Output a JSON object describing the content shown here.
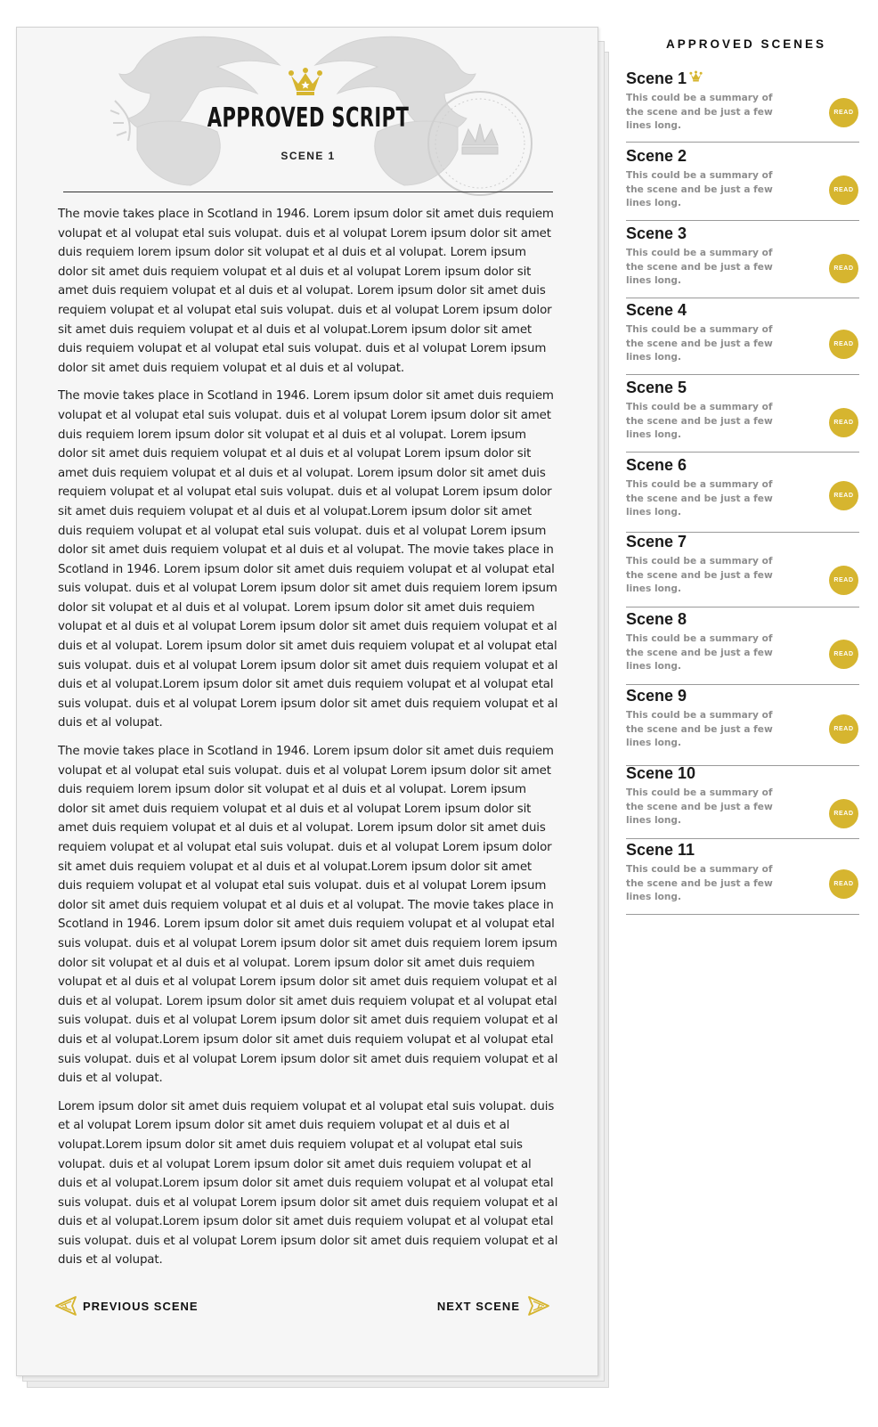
{
  "script": {
    "title": "APPROVED SCRIPT",
    "current_scene": "SCENE 1",
    "paragraphs": [
      "The movie takes place in Scotland in 1946. Lorem ipsum dolor sit amet duis requiem volupat et al volupat etal suis volupat. duis et al volupat Lorem ipsum dolor sit amet duis requiem lorem ipsum dolor sit volupat et al duis et al volupat. Lorem ipsum dolor sit amet duis requiem volupat et al duis et al volupat Lorem ipsum dolor sit amet duis requiem volupat et al duis et al volupat. Lorem ipsum dolor sit amet duis requiem volupat et al volupat etal suis volupat. duis et al volupat Lorem ipsum dolor sit amet duis requiem volupat et al duis et al volupat.Lorem ipsum dolor sit amet duis requiem volupat et al volupat etal suis volupat. duis et al volupat Lorem ipsum dolor sit amet duis requiem volupat et al duis et al volupat.",
      "The movie takes place in Scotland in 1946. Lorem ipsum dolor sit amet duis requiem volupat et al volupat etal suis volupat. duis et al volupat Lorem ipsum dolor sit amet duis requiem lorem ipsum dolor sit volupat et al duis et al volupat. Lorem ipsum dolor sit amet duis requiem volupat et al duis et al volupat Lorem ipsum dolor sit amet duis requiem volupat et al duis et al volupat. Lorem ipsum dolor sit amet duis requiem volupat et al volupat etal suis volupat. duis et al volupat Lorem ipsum dolor sit amet duis requiem volupat et al duis et al volupat.Lorem ipsum dolor sit amet duis requiem volupat et al volupat etal suis volupat. duis et al volupat Lorem ipsum dolor sit amet duis requiem volupat et al duis et al volupat. The movie takes place in Scotland in 1946. Lorem ipsum dolor sit amet duis requiem volupat et al volupat etal suis volupat. duis et al volupat Lorem ipsum dolor sit amet duis requiem lorem ipsum dolor sit volupat et al duis et al volupat. Lorem ipsum dolor sit amet duis requiem volupat et al duis et al volupat Lorem ipsum dolor sit amet duis requiem volupat et al duis et al volupat. Lorem ipsum dolor sit amet duis requiem volupat et al volupat etal suis volupat. duis et al volupat Lorem ipsum dolor sit amet duis requiem volupat et al duis et al volupat.Lorem ipsum dolor sit amet duis requiem volupat et al volupat etal suis volupat. duis et al volupat Lorem ipsum dolor sit amet duis requiem volupat et al duis et al volupat.",
      "The movie takes place in Scotland in 1946. Lorem ipsum dolor sit amet duis requiem volupat et al volupat etal suis volupat. duis et al volupat Lorem ipsum dolor sit amet duis requiem lorem ipsum dolor sit volupat et al duis et al volupat. Lorem ipsum dolor sit amet duis requiem volupat et al duis et al volupat Lorem ipsum dolor sit amet duis requiem volupat et al duis et al volupat. Lorem ipsum dolor sit amet duis requiem volupat et al volupat etal suis volupat. duis et al volupat Lorem ipsum dolor sit amet duis requiem volupat et al duis et al volupat.Lorem ipsum dolor sit amet duis requiem volupat et al volupat etal suis volupat. duis et al volupat Lorem ipsum dolor sit amet duis requiem volupat et al duis et al volupat. The movie takes place in Scotland in 1946. Lorem ipsum dolor sit amet duis requiem volupat et al volupat etal suis volupat. duis et al volupat Lorem ipsum dolor sit amet duis requiem lorem ipsum dolor sit volupat et al duis et al volupat. Lorem ipsum dolor sit amet duis requiem volupat et al duis et al volupat Lorem ipsum dolor sit amet duis requiem volupat et al duis et al volupat. Lorem ipsum dolor sit amet duis requiem volupat et al volupat etal suis volupat. duis et al volupat Lorem ipsum dolor sit amet duis requiem volupat et al duis et al volupat.Lorem ipsum dolor sit amet duis requiem volupat et al volupat etal suis volupat. duis et al volupat Lorem ipsum dolor sit amet duis requiem volupat et al duis et al volupat.",
      "Lorem ipsum dolor sit amet duis requiem volupat et al volupat etal suis volupat. duis et al volupat Lorem ipsum dolor sit amet duis requiem volupat et al duis et al volupat.Lorem ipsum dolor sit amet duis requiem volupat et al volupat etal suis volupat. duis et al volupat Lorem ipsum dolor sit amet duis requiem volupat et al duis et al volupat.Lorem ipsum dolor sit amet duis requiem volupat et al volupat etal suis volupat. duis et al volupat Lorem ipsum dolor sit amet duis requiem volupat et al duis et al volupat.Lorem ipsum dolor sit amet duis requiem volupat et al volupat etal suis volupat. duis et al volupat Lorem ipsum dolor sit amet duis requiem volupat et al duis et al volupat."
    ],
    "prev_label": "PREVIOUS SCENE",
    "next_label": "NEXT SCENE"
  },
  "sidebar": {
    "heading": "APPROVED SCENES",
    "read_label": "READ",
    "scenes": [
      {
        "name": "Scene 1",
        "summary": "This could be a summary of the scene and be just a few lines long.",
        "current": true
      },
      {
        "name": "Scene 2",
        "summary": "This could be a summary of the scene and be just a few lines long.",
        "current": false
      },
      {
        "name": "Scene 3",
        "summary": "This could be a summary of the scene and be just a few lines long.",
        "current": false
      },
      {
        "name": "Scene 4",
        "summary": "This could be a summary of the scene and be just a few lines long.",
        "current": false
      },
      {
        "name": "Scene 5",
        "summary": "This could be a summary of the scene and be just a few lines long.",
        "current": false
      },
      {
        "name": "Scene 6",
        "summary": "This could be a summary of the scene and be just a few lines long.",
        "current": false
      },
      {
        "name": "Scene 7",
        "summary": "This could be a summary of the scene and be just a few lines long.",
        "current": false
      },
      {
        "name": "Scene 8",
        "summary": "This could be a summary of the scene and be just a few lines long.",
        "current": false
      },
      {
        "name": "Scene 9",
        "summary": "This could be a summary of the scene and be just a few lines long.",
        "current": false
      },
      {
        "name": "Scene 10",
        "summary": "This could be a summary of the scene and be just a few lines long.",
        "current": false
      },
      {
        "name": "Scene 11",
        "summary": "This could be a summary of the scene and be just a few lines long.",
        "current": false
      }
    ]
  },
  "colors": {
    "accent": "#d6b52f",
    "paper": "#f6f6f6",
    "summary_text": "#8e8e8e"
  },
  "icons": {
    "title_crown": "crown-icon",
    "scene_marker": "crown-icon",
    "prev": "arrow-left-icon",
    "next": "arrow-right-icon",
    "seal": "stamp-seal"
  }
}
